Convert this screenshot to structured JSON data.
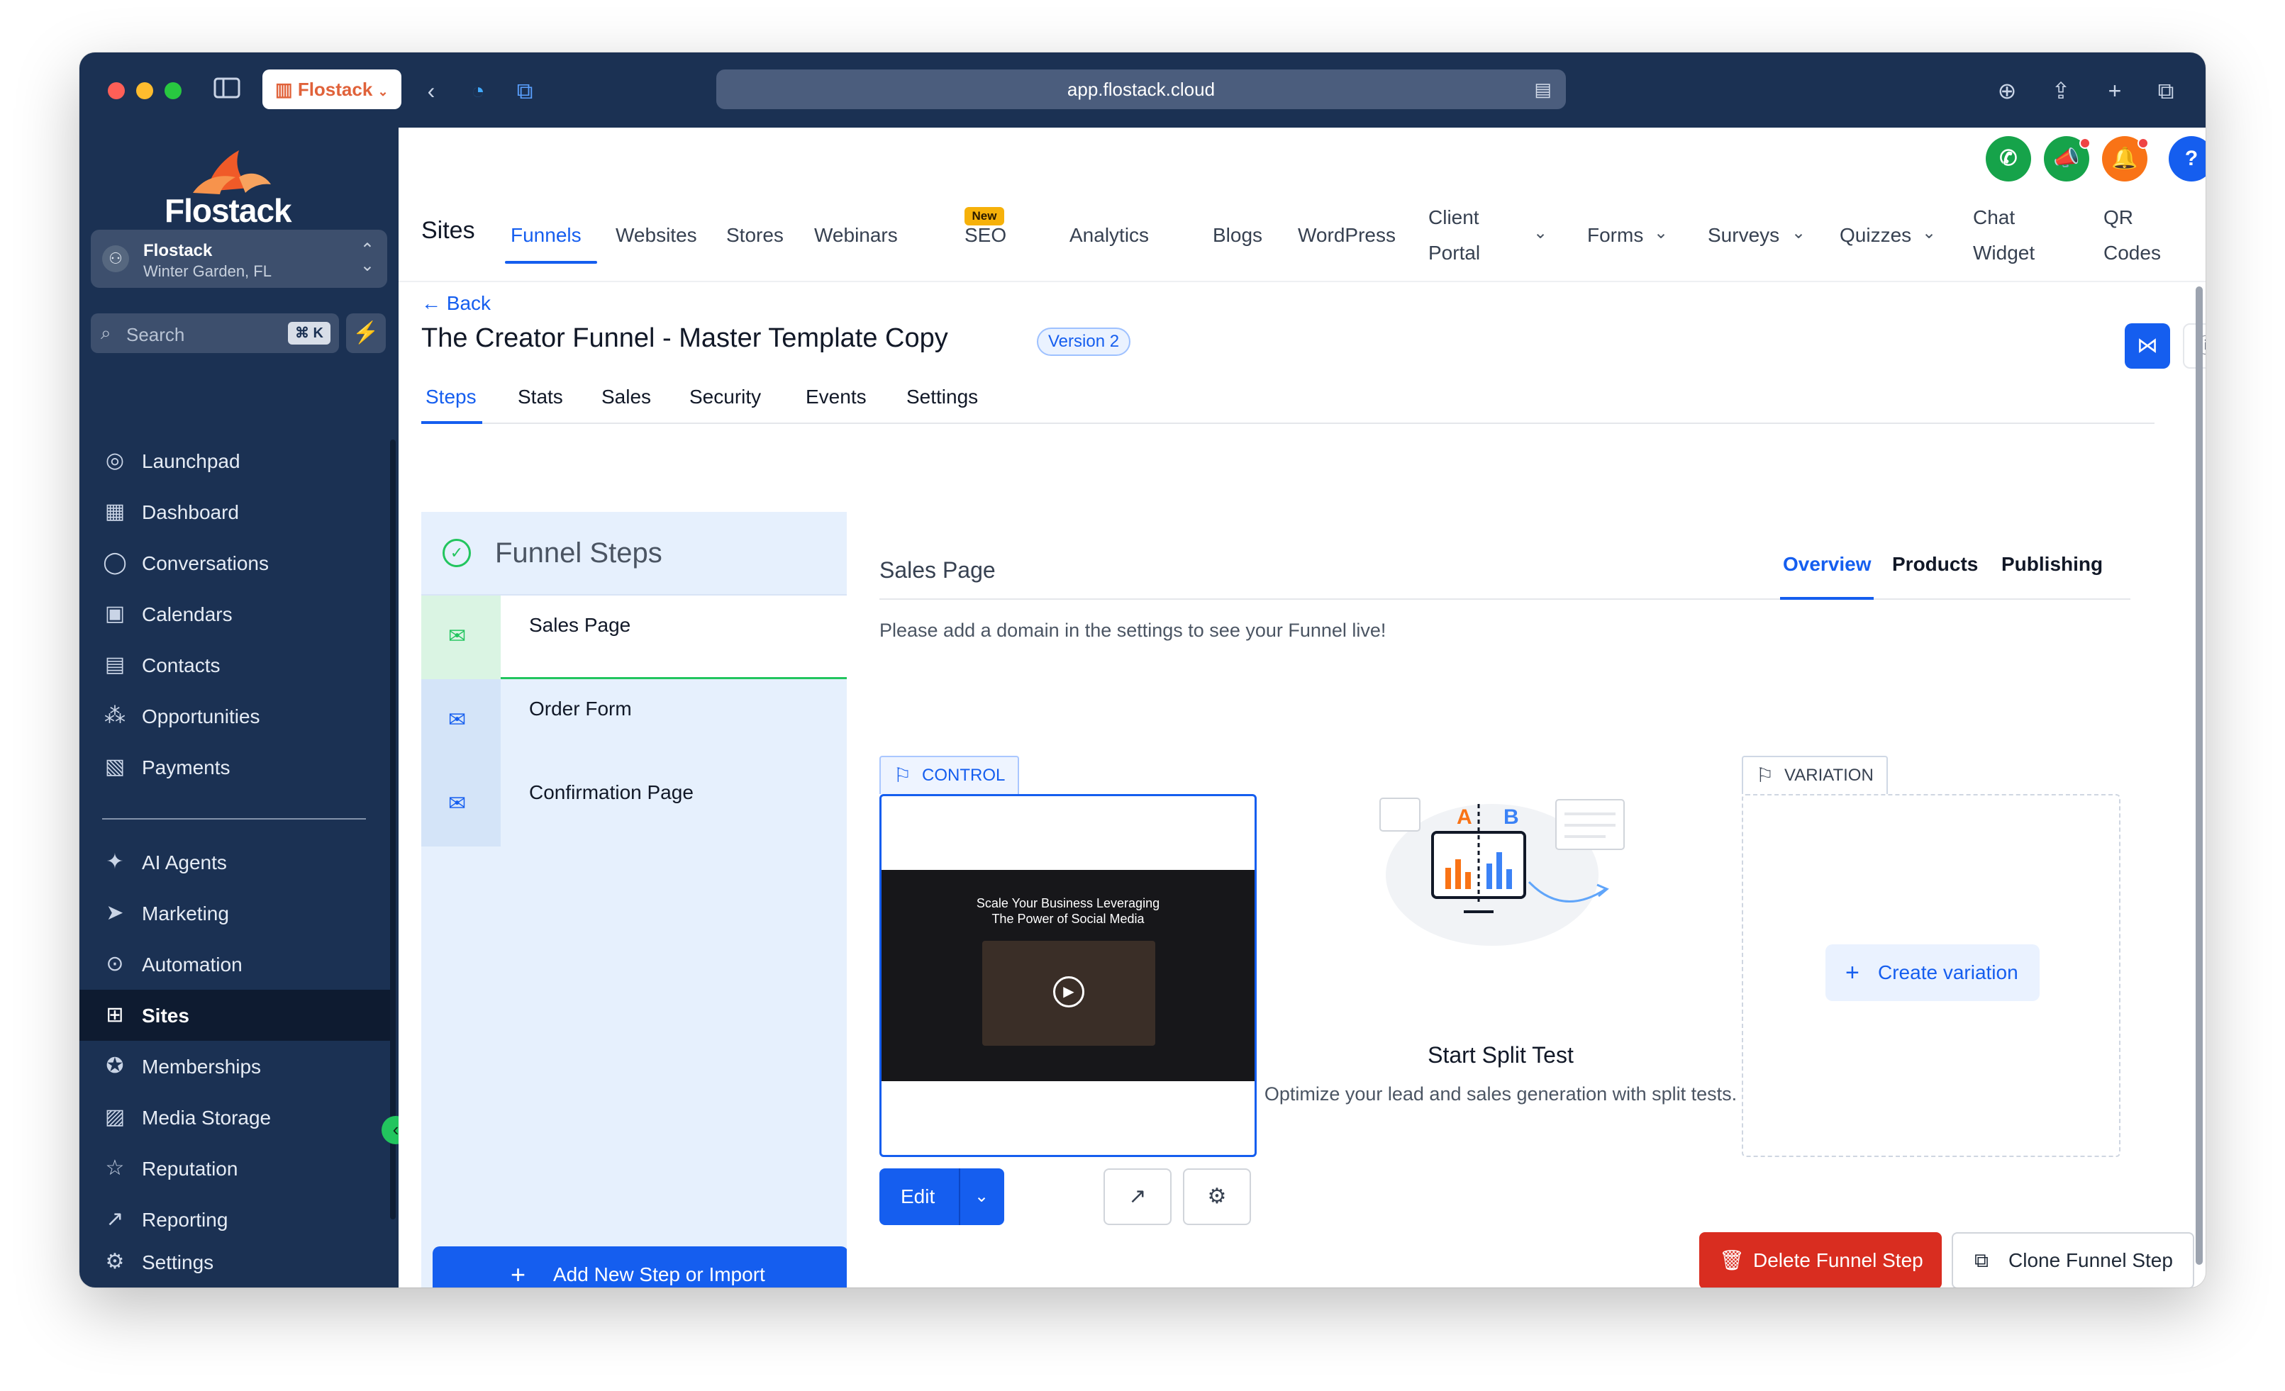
{
  "browser": {
    "tab_label": "Flostack",
    "url": "app.flostack.cloud"
  },
  "sidebar": {
    "logo_text": "Flostack",
    "account": {
      "name": "Flostack",
      "location": "Winter Garden, FL"
    },
    "search": {
      "placeholder": "Search",
      "shortcut": "⌘ K"
    },
    "items": [
      {
        "label": "Launchpad",
        "icon": "launchpad-icon"
      },
      {
        "label": "Dashboard",
        "icon": "dashboard-icon"
      },
      {
        "label": "Conversations",
        "icon": "chat-icon"
      },
      {
        "label": "Calendars",
        "icon": "calendar-icon"
      },
      {
        "label": "Contacts",
        "icon": "contacts-icon"
      },
      {
        "label": "Opportunities",
        "icon": "opportunities-icon"
      },
      {
        "label": "Payments",
        "icon": "payments-icon"
      },
      {
        "label": "AI Agents",
        "icon": "sparkle-icon"
      },
      {
        "label": "Marketing",
        "icon": "send-icon"
      },
      {
        "label": "Automation",
        "icon": "automation-icon"
      },
      {
        "label": "Sites",
        "icon": "sites-icon"
      },
      {
        "label": "Memberships",
        "icon": "badge-icon"
      },
      {
        "label": "Media Storage",
        "icon": "image-icon"
      },
      {
        "label": "Reputation",
        "icon": "star-icon"
      },
      {
        "label": "Reporting",
        "icon": "trend-icon"
      },
      {
        "label": "Settings",
        "icon": "gear-icon"
      }
    ],
    "active_item": "Sites"
  },
  "topnav": {
    "title": "Sites",
    "items": [
      "Funnels",
      "Websites",
      "Stores",
      "Webinars",
      "SEO",
      "Analytics",
      "Blogs",
      "WordPress"
    ],
    "seo_badge": "New",
    "client_portal": [
      "Client",
      "Portal"
    ],
    "dropdowns": [
      "Forms",
      "Surveys",
      "Quizzes"
    ],
    "chat_widget": [
      "Chat",
      "Widget"
    ],
    "qr_codes": [
      "QR",
      "Codes"
    ],
    "active": "Funnels"
  },
  "header": {
    "back_label": "Back",
    "funnel_title": "The Creator Funnel - Master Template Copy",
    "version_badge": "Version 2"
  },
  "subtabs": [
    "Steps",
    "Stats",
    "Sales",
    "Security",
    "Events",
    "Settings"
  ],
  "steps_panel": {
    "title": "Funnel Steps",
    "steps": [
      "Sales Page",
      "Order Form",
      "Confirmation Page"
    ],
    "active_step": "Sales Page",
    "add_button": "Add New Step or Import"
  },
  "detail": {
    "title": "Sales Page",
    "tabs": [
      "Overview",
      "Products",
      "Publishing"
    ],
    "active_tab": "Overview",
    "domain_note": "Please add a domain in the settings to see your Funnel live!",
    "control_label": "CONTROL",
    "variation_label": "VARIATION",
    "preview_headline": [
      "Scale Your Business Leveraging",
      "The Power of Social Media"
    ],
    "edit_label": "Edit",
    "split_test": {
      "title": "Start Split Test",
      "subtitle": "Optimize your lead and sales generation with split tests.",
      "labels": [
        "A",
        "B"
      ]
    },
    "create_variation": "Create variation",
    "delete_button": "Delete Funnel Step",
    "clone_button": "Clone Funnel Step"
  },
  "colors": {
    "primary": "#155eef",
    "sidebar_bg": "#1b3153",
    "danger": "#d92d20",
    "success": "#22c55e"
  }
}
